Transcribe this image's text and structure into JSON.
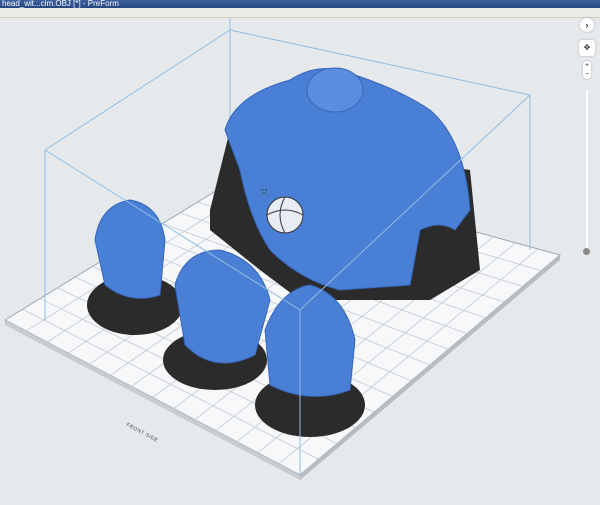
{
  "window": {
    "title": "head_wit...cim.OBJ [*] - PreForm"
  },
  "viewport": {
    "platform_label": "FRONT SIDE",
    "model_color": "#4a7fd6",
    "support_color": "#2b2b2b",
    "box_line_color": "#7fb3e0"
  },
  "controls": {
    "expand_icon": "›",
    "pan_icon": "✥",
    "zoom_in": "+",
    "zoom_out": "−"
  }
}
